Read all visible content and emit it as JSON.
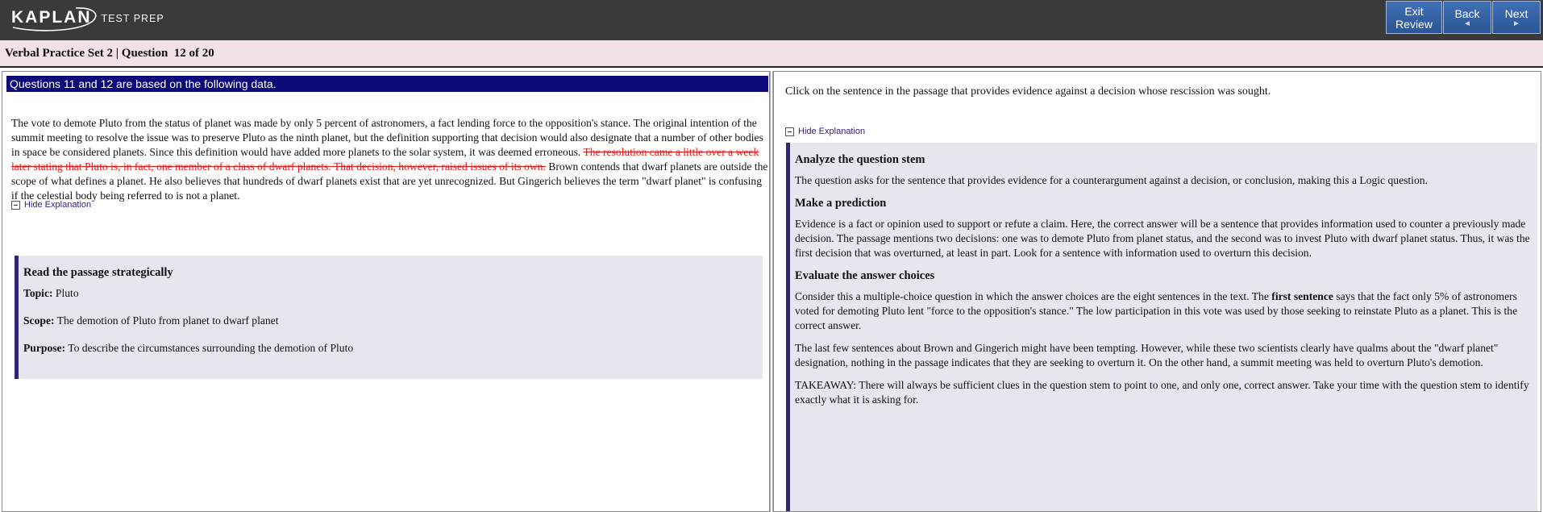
{
  "app": {
    "logo_name": "KAPLAN",
    "logo_sub": "TEST PREP"
  },
  "nav": {
    "exit_line1": "Exit",
    "exit_line2": "Review",
    "back_label": "Back",
    "next_label": "Next",
    "back_arrow": "◄",
    "next_arrow": "►"
  },
  "header": {
    "set_title": "Verbal Practice Set 2 | Question",
    "question_count": "12 of 20"
  },
  "passage": {
    "heading": "Questions 11 and 12 are based on the following data.",
    "text_before": "The vote to demote Pluto from the status of planet was made by only 5 percent of astronomers, a fact lending force to the opposition's stance. The original intention of the summit meeting to resolve the issue was to preserve Pluto as the ninth planet, but the definition supporting that decision would also designate that a number of other bodies in space be considered planets. Since this definition would have added more planets to the solar system, it was deemed erroneous. ",
    "text_struck": "The resolution came a little over a week later stating that Pluto is, in fact, one member of a class of dwarf planets. That decision, however, raised issues of its own.",
    "text_after": " Brown contends that dwarf planets are outside the scope of what defines a planet. He also believes that hundreds of dwarf planets exist that are yet unrecognized. But Gingerich believes the term \"dwarf planet\" is confusing if the celestial body being referred to is not a planet."
  },
  "left_explanation": {
    "toggle_label": "Hide Explanation",
    "heading": "Read the passage strategically",
    "topic_label": "Topic:",
    "topic_value": " Pluto",
    "scope_label": "Scope:",
    "scope_value": " The demotion of Pluto from planet to dwarf planet",
    "purpose_label": "Purpose:",
    "purpose_value": " To describe the circumstances surrounding the demotion of Pluto"
  },
  "question": {
    "prompt": "Click on the sentence in the passage that provides evidence against a decision whose rescission was sought."
  },
  "right_explanation": {
    "toggle_label": "Hide Explanation",
    "h1": "Analyze the question stem",
    "p1": "The question asks for the sentence that provides evidence for a counterargument against a decision, or conclusion, making this a Logic question.",
    "h2": "Make a prediction",
    "p2": "Evidence is a fact or opinion used to support or refute a claim. Here, the correct answer will be a sentence that provides information used to counter a previously made decision. The passage mentions two decisions: one was to demote Pluto from planet status, and the second was to invest Pluto with dwarf planet status. Thus, it was the first decision that was overturned, at least in part. Look for a sentence with information used to overturn this decision.",
    "h3": "Evaluate the answer choices",
    "p3_before": "Consider this a multiple-choice question in which the answer choices are the eight sentences in the text. The ",
    "p3_bold": "first sentence",
    "p3_after": " says that the fact only 5% of astronomers voted for demoting Pluto lent \"force to the opposition's stance.\" The low participation in this vote was used by those seeking to reinstate Pluto as a planet. This is the correct answer.",
    "p4": "The last few sentences about Brown and Gingerich might have been tempting. However, while these two scientists clearly have qualms about the \"dwarf planet\" designation, nothing in the passage indicates that they are seeking to overturn it. On the other hand, a summit meeting was held to overturn Pluto's demotion.",
    "p5": "TAKEAWAY: There will always be sufficient clues in the question stem to point to one, and only one, correct answer. Take your time with the question stem to identify exactly what it is asking for."
  }
}
